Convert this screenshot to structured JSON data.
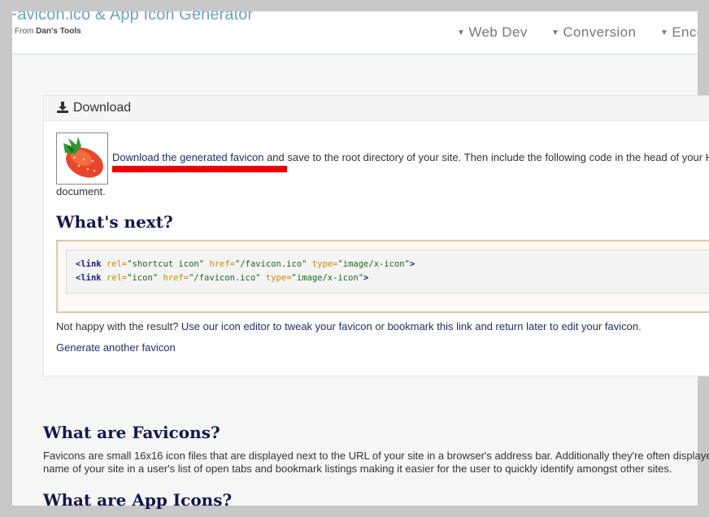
{
  "header": {
    "title": "Favicon.ico & App Icon Generator",
    "subtitle_prefix": "From",
    "subtitle_brand": "Dan's Tools",
    "nav": [
      {
        "label": "Web Dev"
      },
      {
        "label": "Conversion"
      },
      {
        "label": "Encod"
      }
    ]
  },
  "download_card": {
    "heading": "Download",
    "download_link": "Download the generated favicon",
    "line1_rest": " and save to the root directory of your site. Then include the following code in the head of your H",
    "line2": "document.",
    "whats_next": "What's next?",
    "code_lines": [
      [
        "<link",
        " rel=",
        "\"shortcut icon\"",
        " href=",
        "\"/favicon.ico\"",
        " type=",
        "\"image/x-icon\"",
        ">"
      ],
      [
        "<link",
        " rel=",
        "\"icon\"",
        " href=",
        "\"/favicon.ico\"",
        " type=",
        "\"image/x-icon\"",
        ">"
      ]
    ],
    "unhappy_prefix": "Not happy with the result? ",
    "editor_link": "Use our icon editor to tweak your favicon",
    "unhappy_or": " or ",
    "bookmark_link": "bookmark this link and return later to edit your favicon",
    "unhappy_end": ".",
    "generate_another": "Generate another favicon"
  },
  "info": {
    "what_favicons": "What are Favicons?",
    "fav_line1": "Favicons are small 16x16 icon files that are displayed next to the URL of your site in a browser's address bar. Additionally they're often displaye",
    "fav_line2": "name of your site in a user's list of open tabs and bookmark listings making it easier for the user to quickly identify amongst other sites.",
    "what_app_icons": "What are App Icons?"
  },
  "colors": {
    "brand": "#6aa2c9",
    "heading": "#14164e",
    "link": "#1f2e6d",
    "highlight": "#ee0000"
  }
}
